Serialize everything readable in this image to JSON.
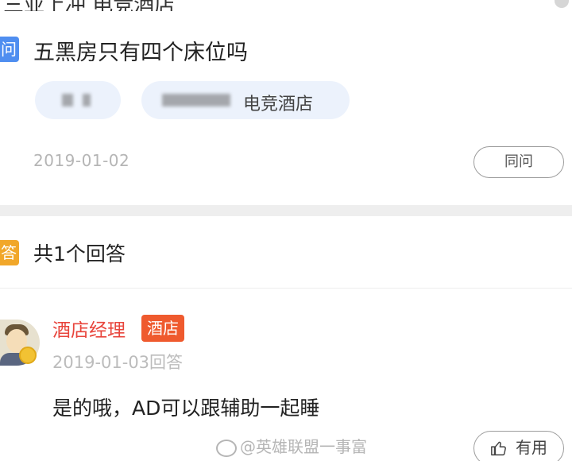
{
  "header": {
    "cut_title": "三亚上冲 电竞酒店"
  },
  "question": {
    "badge": "问",
    "title": "五黑房只有四个床位吗",
    "tag_label": "电竞酒店",
    "date": "2019-01-02",
    "same_question_label": "同问"
  },
  "answers": {
    "badge": "答",
    "count_label": "共1个回答",
    "items": [
      {
        "user_name": "酒店经理",
        "role_badge": "酒店",
        "date": "2019-01-03回答",
        "text": "是的哦，AD可以跟辅助一起睡",
        "useful_label": "有用"
      }
    ]
  },
  "watermark": "@英雄联盟一事富",
  "icons": {
    "thumb": "thumbs-up-icon",
    "avatar": "manager-avatar",
    "medal": "medal-icon",
    "weibo": "weibo-logo-icon"
  },
  "colors": {
    "question_badge": "#4f8ef0",
    "answer_badge": "#f1a72a",
    "user_name": "#e8453c",
    "role_badge": "#ef5a2e",
    "tag_bg": "#ecf2fc"
  }
}
